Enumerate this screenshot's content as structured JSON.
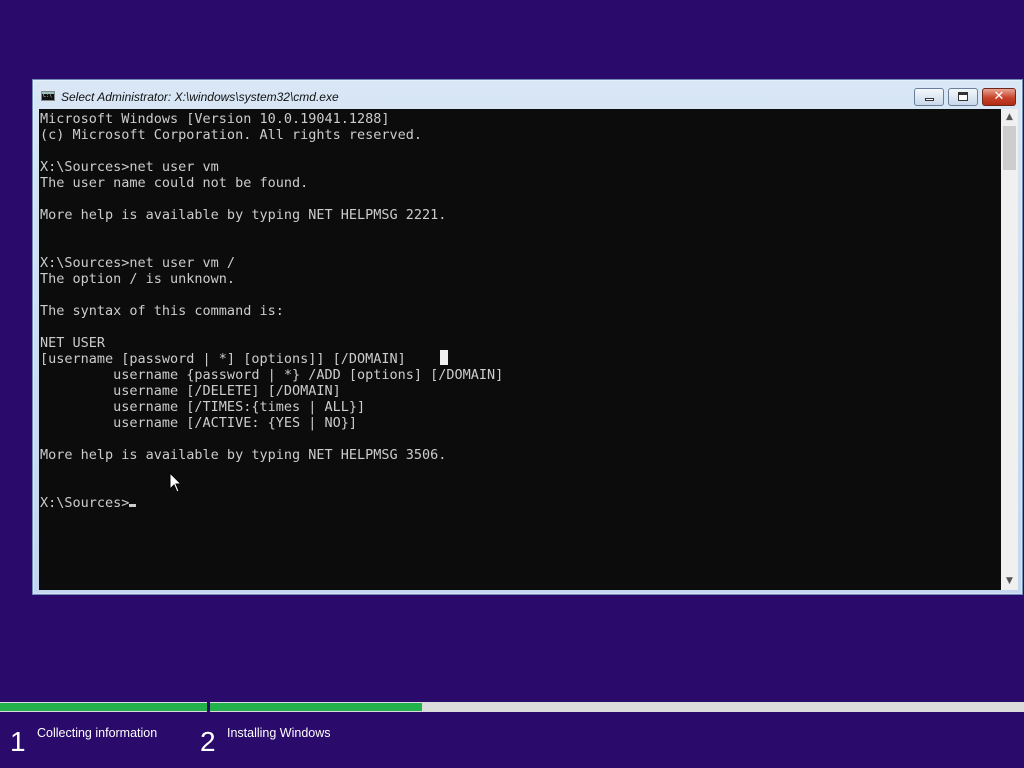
{
  "window": {
    "title": "Select Administrator: X:\\windows\\system32\\cmd.exe",
    "icon": "cmd-icon"
  },
  "console": {
    "lines": [
      "Microsoft Windows [Version 10.0.19041.1288]",
      "(c) Microsoft Corporation. All rights reserved.",
      "",
      "X:\\Sources>net user vm",
      "The user name could not be found.",
      "",
      "More help is available by typing NET HELPMSG 2221.",
      "",
      "",
      "X:\\Sources>net user vm /",
      "The option / is unknown.",
      "",
      "The syntax of this command is:",
      "",
      "NET USER",
      "[username [password | *] [options]] [/DOMAIN]",
      "         username {password | *} /ADD [options] [/DOMAIN]",
      "         username [/DELETE] [/DOMAIN]",
      "         username [/TIMES:{times | ALL}]",
      "         username [/ACTIVE: {YES | NO}]",
      "",
      "More help is available by typing NET HELPMSG 3506.",
      "",
      "",
      "X:\\Sources>"
    ]
  },
  "setup": {
    "steps": [
      {
        "number": "1",
        "label": "Collecting information",
        "progress": 1.0
      },
      {
        "number": "2",
        "label": "Installing Windows",
        "progress": 0.26
      }
    ],
    "progress_color": "#22b14c"
  },
  "colors": {
    "desktop": "#2a0a6b",
    "console_bg": "#0c0c0c",
    "console_fg": "#cccccc"
  }
}
